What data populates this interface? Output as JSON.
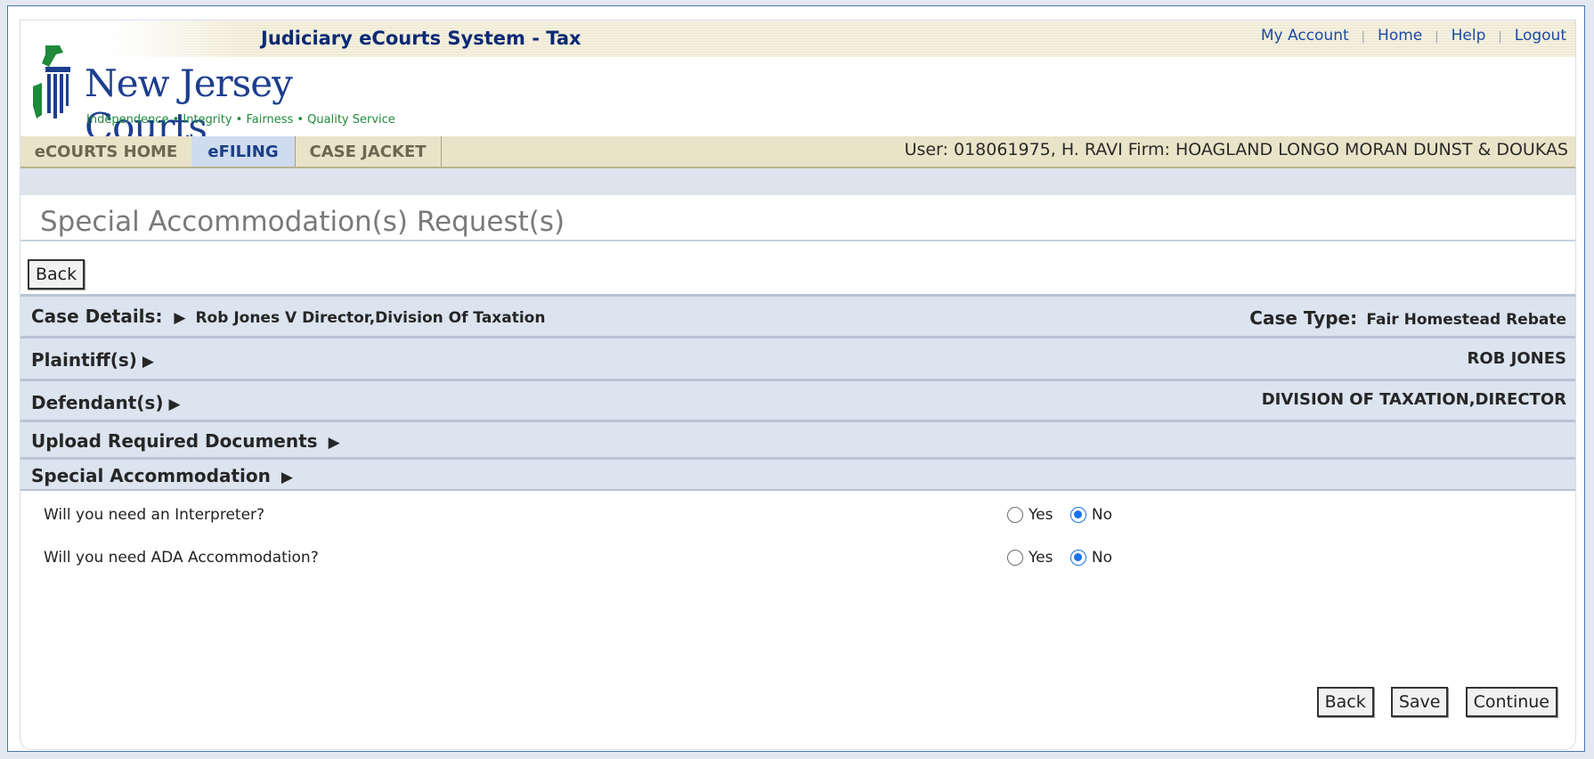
{
  "header": {
    "system_title": "Judiciary eCourts System - Tax",
    "links": [
      "My Account",
      "Home",
      "Help",
      "Logout"
    ],
    "logo_name": "New Jersey Courts",
    "logo_tagline": "Independence • Integrity • Fairness • Quality Service"
  },
  "tabs": [
    {
      "label": "eCOURTS HOME",
      "active": false
    },
    {
      "label": "eFILING",
      "active": true
    },
    {
      "label": "CASE JACKET",
      "active": false
    }
  ],
  "user_info": "User: 018061975, H. RAVI  Firm: HOAGLAND LONGO MORAN DUNST & DOUKAS",
  "page_title": "Special Accommodation(s) Request(s)",
  "back_label": "Back",
  "sections": {
    "case_details": {
      "label": "Case Details:",
      "value": "Rob Jones V Director,Division Of Taxation",
      "case_type_label": "Case Type:",
      "case_type_value": "Fair Homestead Rebate"
    },
    "plaintiffs": {
      "label": "Plaintiff(s)",
      "value": "ROB JONES"
    },
    "defendants": {
      "label": "Defendant(s)",
      "value": "DIVISION OF TAXATION,DIRECTOR"
    },
    "upload": {
      "label": "Upload Required Documents"
    },
    "special": {
      "label": "Special Accommodation"
    }
  },
  "questions": [
    {
      "text": "Will you need an Interpreter?",
      "options": [
        "Yes",
        "No"
      ],
      "selected": "No"
    },
    {
      "text": "Will you need ADA Accommodation?",
      "options": [
        "Yes",
        "No"
      ],
      "selected": "No"
    }
  ],
  "footer_buttons": {
    "back": "Back",
    "save": "Save",
    "continue": "Continue"
  },
  "colors": {
    "accent": "#1a3f86",
    "section_bg": "#dbe4ef",
    "radio_checked": "#1a73e8"
  }
}
